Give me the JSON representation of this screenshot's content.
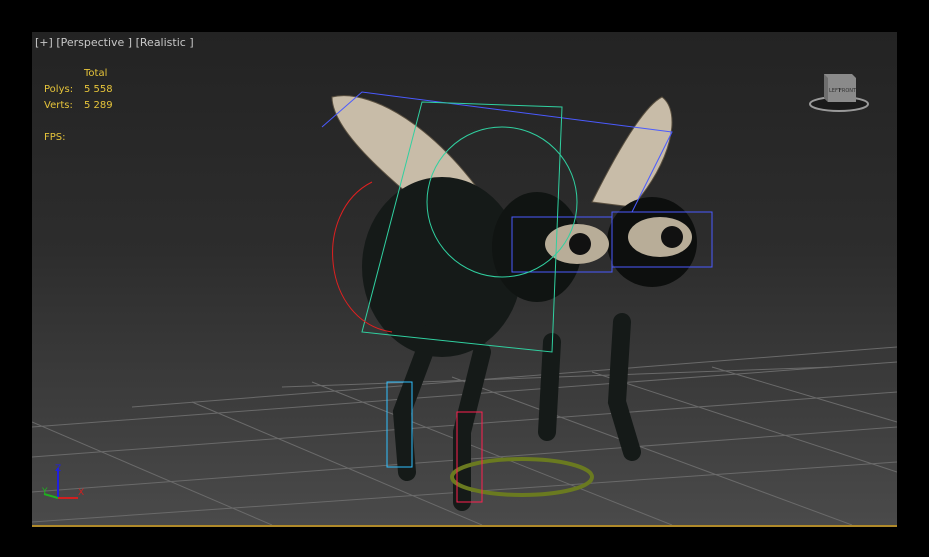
{
  "viewport": {
    "labels": [
      "[+]",
      "[Perspective ]",
      "[Realistic ]"
    ],
    "stats": {
      "header": "Total",
      "polys_label": "Polys:",
      "polys_value": "5 558",
      "verts_label": "Verts:",
      "verts_value": "5 289",
      "fps_label": "FPS:"
    },
    "viewcube": {
      "left_face": "LEFT",
      "front_face": "FRONT"
    },
    "axis": {
      "x": "X",
      "y": "Y",
      "z": "Z"
    }
  },
  "colors": {
    "stats": "#e6c43a",
    "border": "#b08a2a",
    "x": "#d02020",
    "y": "#20b020",
    "z": "#2020e0"
  }
}
